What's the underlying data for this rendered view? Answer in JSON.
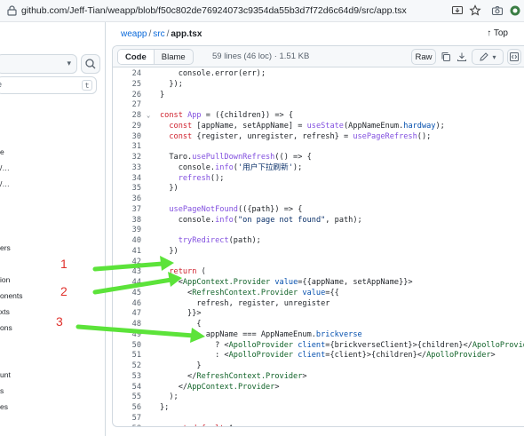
{
  "browser": {
    "url": "github.com/Jeff-Tian/weapp/blob/f50c802de76924073c9354da55b3d7f72d6c64d9/src/app.tsx"
  },
  "sidebar": {
    "filter_shortcut": "t",
    "filter_fragment": "e",
    "tree_fragments": [
      "e",
      "/…",
      "/…",
      "ers",
      "ion",
      "onents",
      "xts",
      "ons",
      "unt",
      "s",
      "es"
    ]
  },
  "header": {
    "breadcrumb": [
      "weapp",
      "src",
      "app.tsx"
    ],
    "top_label": "Top"
  },
  "toolbar": {
    "code_tab": "Code",
    "blame_tab": "Blame",
    "meta": "59 lines (46 loc) · 1.51 KB",
    "raw_label": "Raw"
  },
  "annotations": [
    "1",
    "2",
    "3"
  ],
  "code_lines": [
    {
      "n": "24",
      "html": "    console.error(err);"
    },
    {
      "n": "25",
      "html": "  });"
    },
    {
      "n": "26",
      "html": "}"
    },
    {
      "n": "27",
      "html": ""
    },
    {
      "n": "28",
      "html": "<span class=\"k\">const</span> <span class=\"f\">App</span> = ({children}) => {",
      "fold": true
    },
    {
      "n": "29",
      "html": "  <span class=\"k\">const</span> [appName, setAppName] = <span class=\"f\">useState</span>(AppNameEnum.<span class=\"c\">hardway</span>);"
    },
    {
      "n": "30",
      "html": "  <span class=\"k\">const</span> {register, unregister, refresh} = <span class=\"f\">usePageRefresh</span>();"
    },
    {
      "n": "31",
      "html": ""
    },
    {
      "n": "32",
      "html": "  Taro.<span class=\"f\">usePullDownRefresh</span>(() => {"
    },
    {
      "n": "33",
      "html": "    console.<span class=\"f\">info</span>(<span class=\"s\">'用户下拉刷新'</span>);"
    },
    {
      "n": "34",
      "html": "    <span class=\"f\">refresh</span>();"
    },
    {
      "n": "35",
      "html": "  })"
    },
    {
      "n": "36",
      "html": ""
    },
    {
      "n": "37",
      "html": "  <span class=\"f\">usePageNotFound</span>(({path}) => {"
    },
    {
      "n": "38",
      "html": "    console.<span class=\"f\">info</span>(<span class=\"s\">\"on page not found\"</span>, path);"
    },
    {
      "n": "39",
      "html": ""
    },
    {
      "n": "40",
      "html": "    <span class=\"f\">tryRedirect</span>(path);"
    },
    {
      "n": "41",
      "html": "  })"
    },
    {
      "n": "42",
      "html": ""
    },
    {
      "n": "43",
      "html": "  <span class=\"k\">return</span> ("
    },
    {
      "n": "44",
      "html": "    &lt;<span class=\"t\">AppContext.Provider</span> <span class=\"c\">value</span>={{appName, setAppName}}&gt;"
    },
    {
      "n": "45",
      "html": "      &lt;<span class=\"t\">RefreshContext.Provider</span> <span class=\"c\">value</span>={{"
    },
    {
      "n": "46",
      "html": "        refresh, register, unregister"
    },
    {
      "n": "47",
      "html": "      }}&gt;"
    },
    {
      "n": "48",
      "html": "        {"
    },
    {
      "n": "49",
      "html": "          appName === AppNameEnum.<span class=\"c\">brickverse</span>"
    },
    {
      "n": "50",
      "html": "            ? &lt;<span class=\"t\">ApolloProvider</span> <span class=\"c\">client</span>={brickverseClient}&gt;{children}&lt;/<span class=\"t\">ApolloProvider</span>&gt;"
    },
    {
      "n": "51",
      "html": "            : &lt;<span class=\"t\">ApolloProvider</span> <span class=\"c\">client</span>={client}&gt;{children}&lt;/<span class=\"t\">ApolloProvider</span>&gt;"
    },
    {
      "n": "52",
      "html": "        }"
    },
    {
      "n": "53",
      "html": "      &lt;/<span class=\"t\">RefreshContext.Provider</span>&gt;"
    },
    {
      "n": "54",
      "html": "    &lt;/<span class=\"t\">AppContext.Provider</span>&gt;"
    },
    {
      "n": "55",
      "html": "  );"
    },
    {
      "n": "56",
      "html": "};"
    },
    {
      "n": "57",
      "html": ""
    },
    {
      "n": "58",
      "html": "<span class=\"k\">export</span> <span class=\"k\">default</span> App;"
    }
  ]
}
